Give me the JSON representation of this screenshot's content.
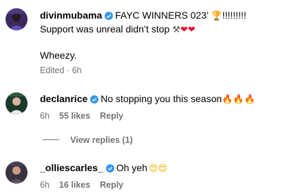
{
  "comments": [
    {
      "username": "divinmubama",
      "text_line1": "FAYC WINNERS 023’",
      "trophy": "🏆",
      "exclaims": "!!!!!!!!!",
      "text_line2": "Support was unreal didn’t stop",
      "emoji_line2_tools": "⚒",
      "emoji_line2_hearts": "❤❤",
      "text_line3": "Wheezy.",
      "edited": "Edited",
      "time": "6h"
    },
    {
      "username": "declanrice",
      "text": "No stopping you this season",
      "emoji": "🔥🔥🔥",
      "time": "6h",
      "likes": "55 likes",
      "reply": "Reply",
      "view_replies": "View replies (1)"
    },
    {
      "username": "_olliescarles_",
      "text": "Oh yeh",
      "emoji": "😍😍",
      "time": "6h",
      "likes": "16 likes",
      "reply": "Reply"
    }
  ],
  "colors": {
    "verified": "#3897f0",
    "meta": "#737373",
    "heart": "#e8132f"
  },
  "icons": [
    "verified-badge-icon",
    "avatar-divinmubama",
    "avatar-declanrice",
    "avatar-olliescarles"
  ]
}
